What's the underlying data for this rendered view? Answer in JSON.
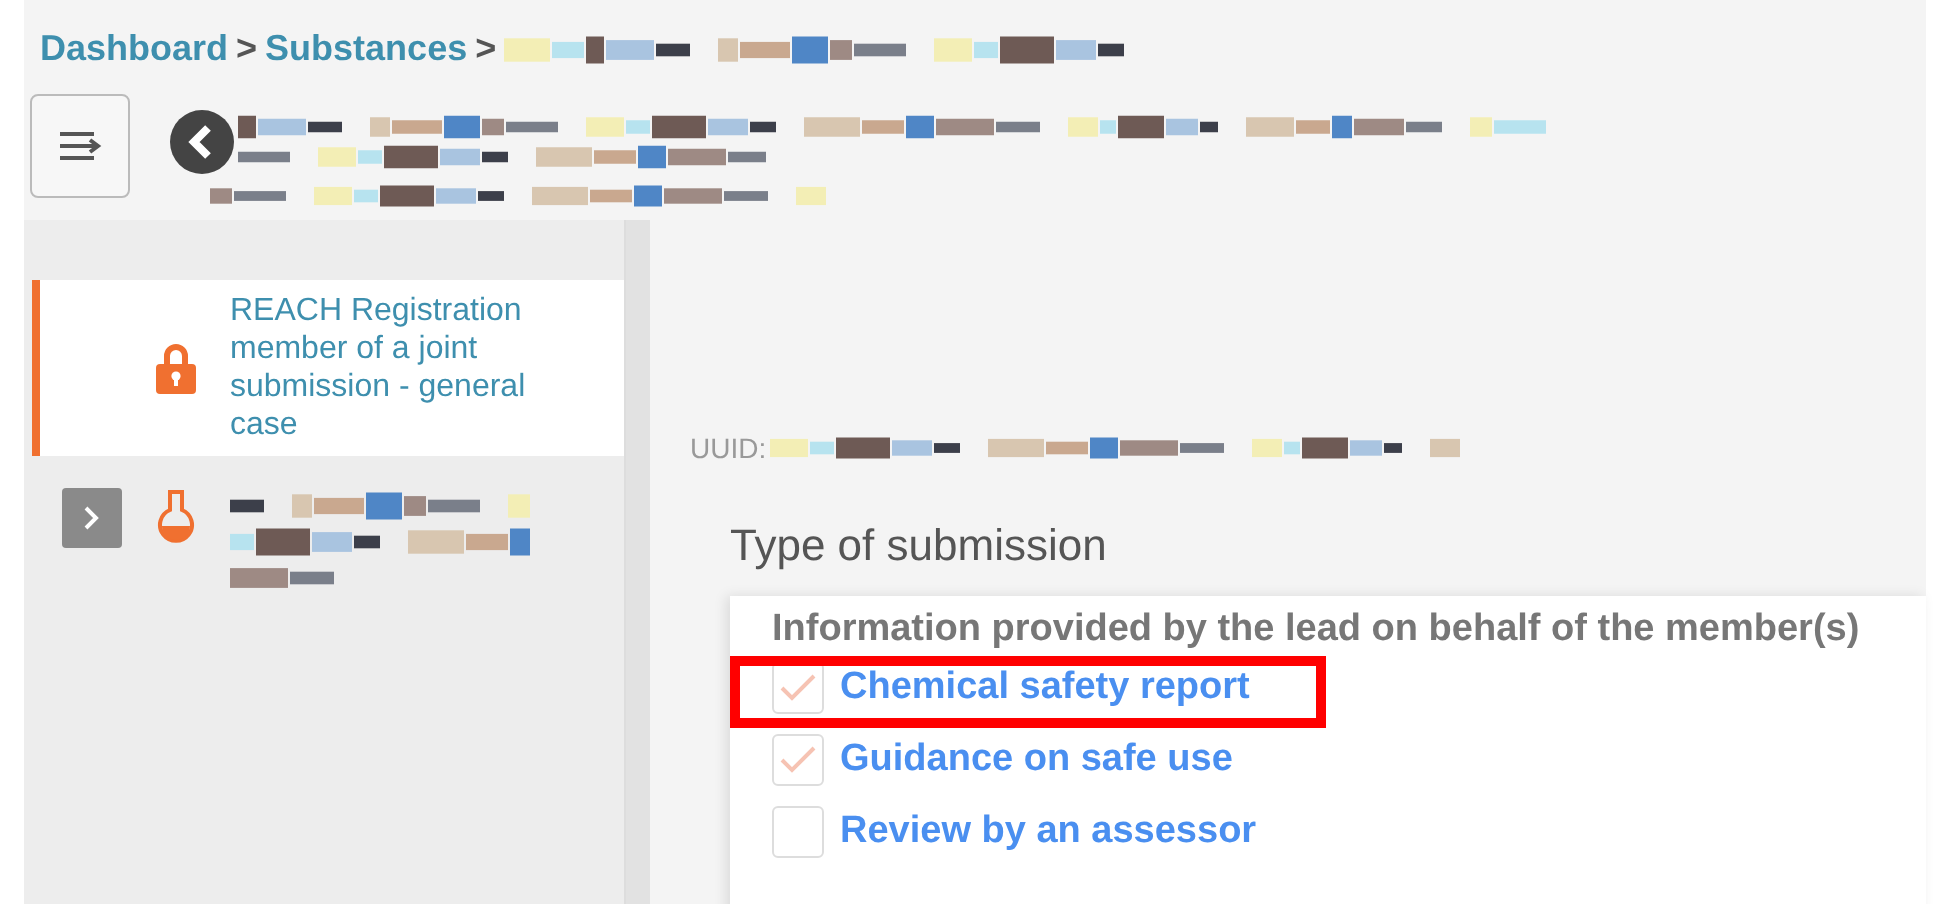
{
  "breadcrumb": [
    {
      "label": "Dashboard"
    },
    {
      "label": "Substances"
    }
  ],
  "breadcrumb_separator": ">",
  "sidebar": {
    "items": [
      {
        "label": "REACH Registration member of a joint submission - general case",
        "kind": "lock",
        "selected": true,
        "expandable": false
      },
      {
        "kind": "flask",
        "selected": false,
        "expandable": true
      }
    ]
  },
  "content": {
    "uuid_label": "UUID:",
    "heading": "Type of submission",
    "panel": {
      "title": "Information provided by the lead on behalf of the member(s)",
      "options": [
        {
          "label": "Chemical safety report",
          "checked": true,
          "highlighted": true
        },
        {
          "label": "Guidance on safe use",
          "checked": true,
          "highlighted": false
        },
        {
          "label": "Review by an assessor",
          "checked": false,
          "highlighted": false
        }
      ]
    }
  }
}
